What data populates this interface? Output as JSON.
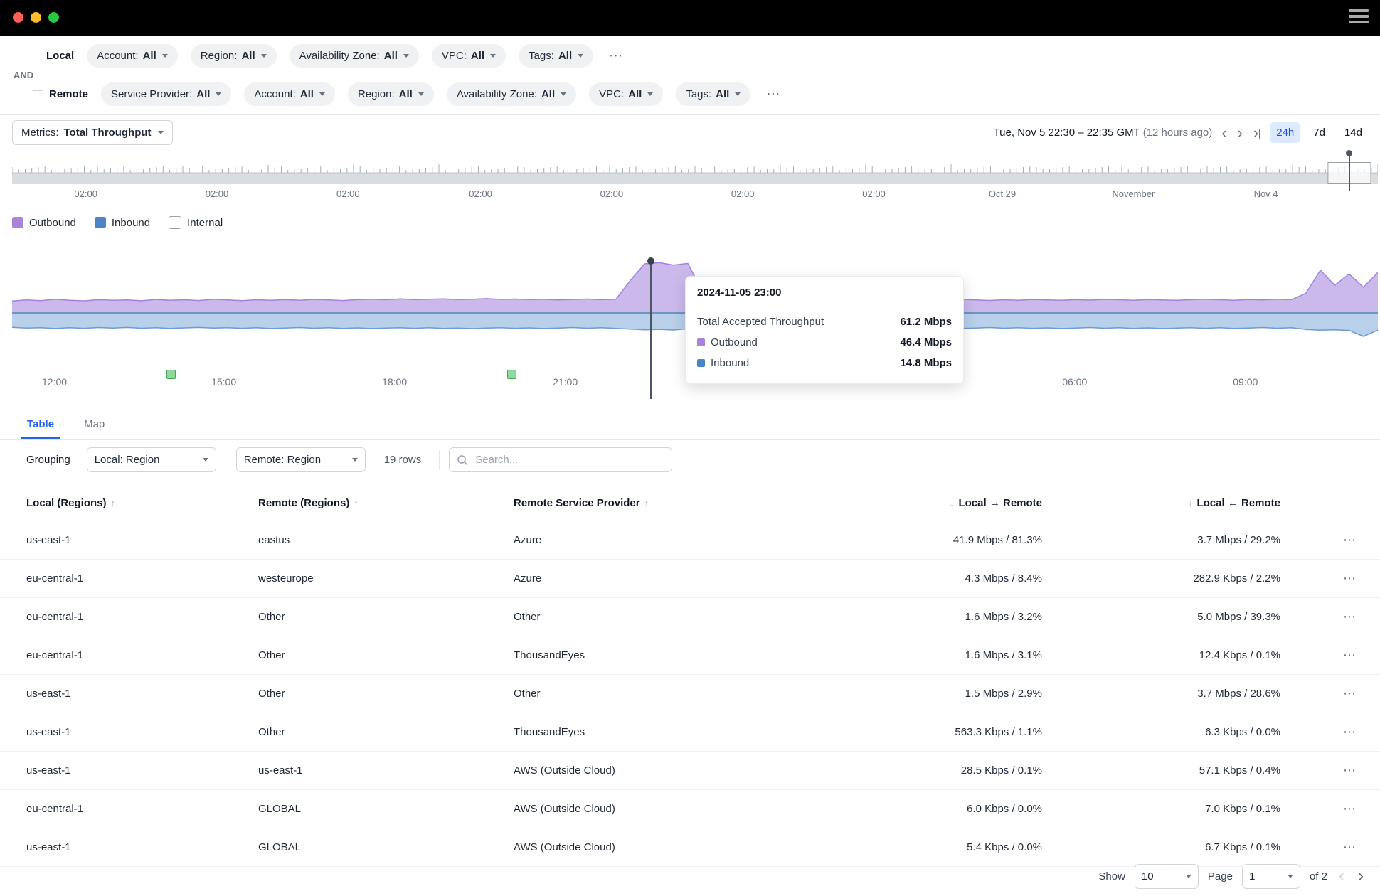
{
  "colors": {
    "accent_blue": "#2563eb",
    "outbound": "#a685d8",
    "inbound": "#4a86c5",
    "annotation_green": "#3fa954",
    "range_active_bg": "#dbeafe",
    "traffic_lights": [
      "#ff5f57",
      "#febc2e",
      "#28c840"
    ]
  },
  "filters": {
    "and_label": "AND",
    "local": {
      "label": "Local",
      "chips": [
        {
          "name": "Account",
          "value": "All"
        },
        {
          "name": "Region",
          "value": "All"
        },
        {
          "name": "Availability Zone",
          "value": "All"
        },
        {
          "name": "VPC",
          "value": "All"
        },
        {
          "name": "Tags",
          "value": "All"
        }
      ],
      "more": "⋯"
    },
    "remote": {
      "label": "Remote",
      "chips": [
        {
          "name": "Service Provider",
          "value": "All"
        },
        {
          "name": "Account",
          "value": "All"
        },
        {
          "name": "Region",
          "value": "All"
        },
        {
          "name": "Availability Zone",
          "value": "All"
        },
        {
          "name": "VPC",
          "value": "All"
        },
        {
          "name": "Tags",
          "value": "All"
        }
      ],
      "more": "⋯"
    }
  },
  "metrics_bar": {
    "metrics_label": "Metrics:",
    "metrics_value": "Total Throughput",
    "date_range": "Tue, Nov 5 22:30 – 22:35 GMT",
    "date_note": "(12 hours ago)",
    "nav": {
      "prev": "‹",
      "next": "›",
      "latest": "›"
    },
    "ranges": [
      {
        "label": "24h",
        "active": true
      },
      {
        "label": "7d",
        "active": false
      },
      {
        "label": "14d",
        "active": false
      }
    ]
  },
  "scrubber": {
    "labels": [
      {
        "text": "02:00",
        "frac": 0.054
      },
      {
        "text": "02:00",
        "frac": 0.15
      },
      {
        "text": "02:00",
        "frac": 0.246
      },
      {
        "text": "02:00",
        "frac": 0.343
      },
      {
        "text": "02:00",
        "frac": 0.439
      },
      {
        "text": "02:00",
        "frac": 0.535
      },
      {
        "text": "02:00",
        "frac": 0.631
      },
      {
        "text": "Oct 29",
        "frac": 0.725
      },
      {
        "text": "November",
        "frac": 0.821
      },
      {
        "text": "Nov 4",
        "frac": 0.918
      }
    ],
    "selection": {
      "start_frac": 0.9635,
      "end_frac": 0.9948,
      "pin_frac": 0.979
    }
  },
  "legend": {
    "items": [
      {
        "label": "Outbound",
        "color": "#a685d8",
        "checked": true
      },
      {
        "label": "Inbound",
        "color": "#4a86c5",
        "checked": true
      },
      {
        "label": "Internal",
        "color": null,
        "checked": false
      }
    ]
  },
  "chart_data": {
    "type": "area",
    "title": "Total Throughput (outbound above baseline, inbound below)",
    "unit": "Mbps",
    "x_start": "2024-11-05 11:15",
    "x_end": "2024-11-06 11:15",
    "x_axis_labels": [
      {
        "text": "12:00",
        "frac": 0.031
      },
      {
        "text": "15:00",
        "frac": 0.155
      },
      {
        "text": "18:00",
        "frac": 0.28
      },
      {
        "text": "21:00",
        "frac": 0.405
      },
      {
        "text": "06:00",
        "frac": 0.778
      },
      {
        "text": "09:00",
        "frac": 0.903
      }
    ],
    "series": [
      {
        "name": "Outbound",
        "color_fill": "#cbb9ec",
        "color_line": "#a282dd",
        "values": [
          11.2,
          12.1,
          11.5,
          12.8,
          11.9,
          11.3,
          12.4,
          11.8,
          12.2,
          11.4,
          12.6,
          11.9,
          12.3,
          11.6,
          12.8,
          12.1,
          11.5,
          12.3,
          11.8,
          12.5,
          11.9,
          12.7,
          12.2,
          11.6,
          12.4,
          12.9,
          12.3,
          13.1,
          12.5,
          12.8,
          13.2,
          12.6,
          12.9,
          13.4,
          12.7,
          13.0,
          12.5,
          12.8,
          12.2,
          12.6,
          13.0,
          12.4,
          12.8,
          30.5,
          46.0,
          47.2,
          44.8,
          46.4,
          21.0,
          12.8,
          12.2,
          11.8,
          12.4,
          11.9,
          12.6,
          12.1,
          11.7,
          12.3,
          12.8,
          12.2,
          11.8,
          12.5,
          12.0,
          12.6,
          11.9,
          12.4,
          12.8,
          12.1,
          11.7,
          12.3,
          11.9,
          12.6,
          12.2,
          11.8,
          12.4,
          12.0,
          12.7,
          12.3,
          11.9,
          12.5,
          12.1,
          11.8,
          12.4,
          12.9,
          12.3,
          11.9,
          12.6,
          12.2,
          12.8,
          12.4,
          18.5,
          40.0,
          26.0,
          36.5,
          24.0,
          38.0
        ]
      },
      {
        "name": "Inbound",
        "color_fill": "#b9d0ea",
        "color_line": "#6d9bd3",
        "values": [
          13.5,
          14.2,
          13.8,
          14.6,
          13.9,
          14.4,
          13.7,
          14.1,
          13.6,
          14.3,
          13.9,
          14.5,
          14.0,
          13.6,
          14.2,
          13.8,
          14.4,
          13.9,
          14.6,
          14.1,
          13.7,
          14.3,
          13.8,
          14.5,
          14.0,
          14.6,
          14.2,
          13.8,
          14.4,
          13.9,
          14.5,
          14.1,
          14.7,
          14.2,
          13.8,
          14.4,
          14.0,
          14.6,
          14.1,
          13.7,
          14.3,
          13.9,
          14.5,
          15.2,
          15.8,
          15.4,
          16.0,
          14.8,
          14.2,
          13.8,
          14.4,
          13.9,
          14.5,
          14.0,
          14.6,
          14.1,
          13.7,
          14.3,
          13.9,
          14.5,
          14.0,
          14.6,
          14.2,
          13.8,
          14.4,
          13.9,
          14.5,
          14.1,
          13.7,
          14.3,
          13.8,
          14.4,
          14.0,
          14.6,
          14.1,
          13.7,
          14.3,
          13.9,
          14.5,
          14.0,
          14.6,
          14.2,
          13.8,
          14.4,
          13.9,
          14.5,
          14.1,
          13.7,
          14.3,
          13.9,
          15.5,
          16.2,
          15.8,
          16.4,
          22.0,
          16.0
        ]
      }
    ],
    "marker": {
      "frac": 0.4677,
      "timestamp": "2024-11-05 23:00"
    },
    "annotations": [
      {
        "frac": 0.1156,
        "color": "#3fa954"
      },
      {
        "frac": 0.365,
        "color": "#3fa954"
      }
    ]
  },
  "tooltip": {
    "title": "2024-11-05 23:00",
    "total_label": "Total Accepted Throughput",
    "total_value": "61.2 Mbps",
    "rows": [
      {
        "label": "Outbound",
        "value": "46.4 Mbps",
        "color": "#a685d8"
      },
      {
        "label": "Inbound",
        "value": "14.8 Mbps",
        "color": "#4a86c5"
      }
    ]
  },
  "tabs": [
    {
      "label": "Table",
      "active": true
    },
    {
      "label": "Map",
      "active": false
    }
  ],
  "grouping": {
    "label": "Grouping",
    "local_dropdown": "Local: Region",
    "remote_dropdown": "Remote: Region",
    "row_count": "19 rows",
    "search_placeholder": "Search..."
  },
  "table": {
    "columns": [
      {
        "label": "Local (Regions)",
        "sort": "none"
      },
      {
        "label": "Remote (Regions)",
        "sort": "none"
      },
      {
        "label": "Remote Service Provider",
        "sort": "none"
      },
      {
        "label": "Local → Remote",
        "sort": "desc_active",
        "align": "right"
      },
      {
        "label": "Local ← Remote",
        "sort": "desc_inactive",
        "align": "right"
      }
    ],
    "rows": [
      {
        "local": "us-east-1",
        "remote": "eastus",
        "provider": "Azure",
        "ltr": "41.9 Mbps / 81.3%",
        "rtl": "3.7 Mbps / 29.2%"
      },
      {
        "local": "eu-central-1",
        "remote": "westeurope",
        "provider": "Azure",
        "ltr": "4.3 Mbps / 8.4%",
        "rtl": "282.9 Kbps / 2.2%"
      },
      {
        "local": "eu-central-1",
        "remote": "Other",
        "provider": "Other",
        "ltr": "1.6 Mbps / 3.2%",
        "rtl": "5.0 Mbps / 39.3%"
      },
      {
        "local": "eu-central-1",
        "remote": "Other",
        "provider": "ThousandEyes",
        "ltr": "1.6 Mbps / 3.1%",
        "rtl": "12.4 Kbps / 0.1%"
      },
      {
        "local": "us-east-1",
        "remote": "Other",
        "provider": "Other",
        "ltr": "1.5 Mbps / 2.9%",
        "rtl": "3.7 Mbps / 28.6%"
      },
      {
        "local": "us-east-1",
        "remote": "Other",
        "provider": "ThousandEyes",
        "ltr": "563.3 Kbps / 1.1%",
        "rtl": "6.3 Kbps / 0.0%"
      },
      {
        "local": "us-east-1",
        "remote": "us-east-1",
        "provider": "AWS (Outside Cloud)",
        "ltr": "28.5 Kbps / 0.1%",
        "rtl": "57.1 Kbps / 0.4%"
      },
      {
        "local": "eu-central-1",
        "remote": "GLOBAL",
        "provider": "AWS (Outside Cloud)",
        "ltr": "6.0 Kbps / 0.0%",
        "rtl": "7.0 Kbps / 0.1%"
      },
      {
        "local": "us-east-1",
        "remote": "GLOBAL",
        "provider": "AWS (Outside Cloud)",
        "ltr": "5.4 Kbps / 0.0%",
        "rtl": "6.7 Kbps / 0.1%"
      }
    ]
  },
  "pagination": {
    "show_label": "Show",
    "show_value": "10",
    "page_label": "Page",
    "page_value": "1",
    "of_label": "of 2",
    "prev": "‹",
    "next": "›"
  }
}
